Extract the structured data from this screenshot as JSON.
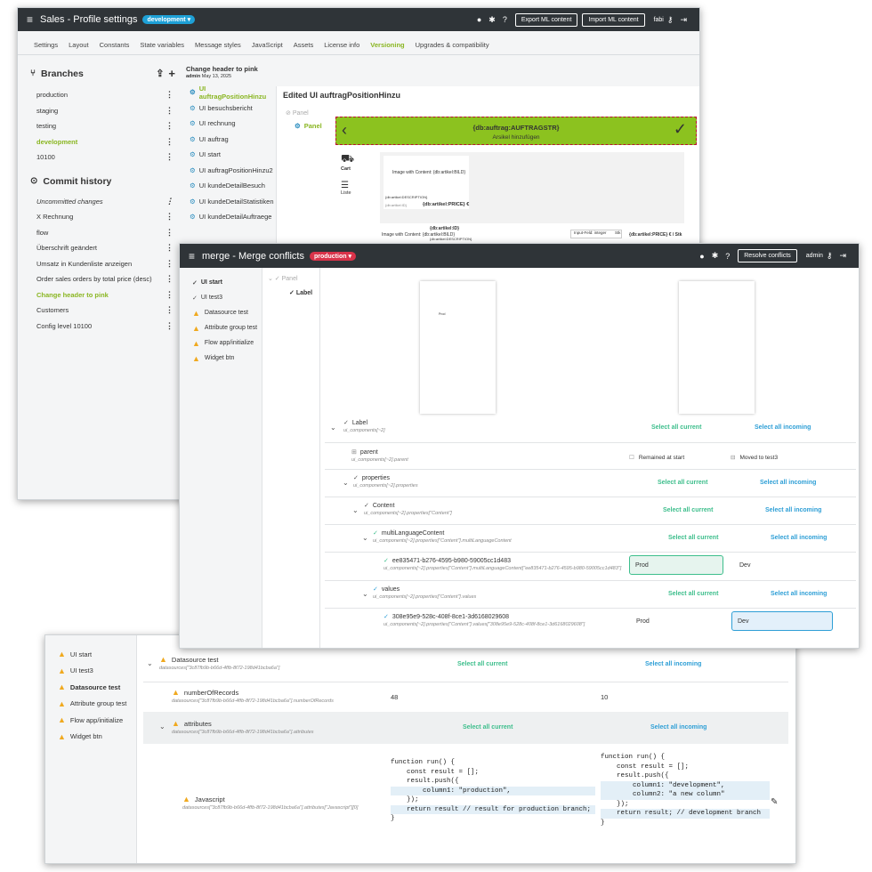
{
  "win1": {
    "title": "Sales - Profile settings",
    "branch_pill": "development ▾",
    "buttons": [
      "Export ML content",
      "Import ML content"
    ],
    "user": "fabi",
    "tabs": [
      "Settings",
      "Layout",
      "Constants",
      "State variables",
      "Message styles",
      "JavaScript",
      "Assets",
      "License info",
      "Versioning",
      "Upgrades & compatibility"
    ],
    "active_tab": "Versioning",
    "branches_title": "Branches",
    "branches": [
      "production",
      "staging",
      "testing",
      "development",
      "10100"
    ],
    "commit_title": "Commit history",
    "commits": [
      "Uncommitted changes",
      "X Rechnung",
      "flow",
      "Überschrift geändert",
      "Umsatz in Kundenliste anzeigen",
      "Order sales orders by total price (desc)",
      "Change header to pink",
      "Customers",
      "Config level 10100"
    ],
    "commit_head": {
      "title": "Change header to pink",
      "author": "admin",
      "date": "May 13, 2025"
    },
    "ui_list": [
      "UI auftragPositionHinzu",
      "UI besuchsbericht",
      "UI rechnung",
      "UI auftrag",
      "UI start",
      "UI auftragPositionHinzu2",
      "UI kundeDetailBesuch",
      "UI kundeDetailStatistiken",
      "UI kundeDetailAuftraege"
    ],
    "edited_title": "Edited UI auftragPositionHinzu",
    "tree": [
      "Panel",
      "Panel"
    ],
    "preview": {
      "header_title": "{db:auftrag:AUFTRAGSTR}",
      "header_sub": "Arsikel hinzufügen",
      "cart": "Cart",
      "liste": "Liste",
      "img1": "Image with Content: {db:artikel:BILD}",
      "desc": "{db:artikel:DESCRIPTION}",
      "artid": "{db:artikel:ID}",
      "price": "{db:artikel:PRICE} €",
      "img2": "Image with Content: {db:artikel:BILD}",
      "artid2": "{db:artikel:ID}",
      "desc2": "{db:artikel:DESCRIPTION}",
      "input_field": "Input-Feld: integer",
      "stk": "Stk",
      "price2": "{db:artikel:PRICE} € / Stk"
    }
  },
  "win2": {
    "title": "merge - Merge conflicts",
    "branch_pill": "production ▾",
    "resolve": "Resolve conflicts",
    "user": "admin",
    "nav": [
      "UI start",
      "UI test3",
      "Datasource test",
      "Attribute group test",
      "Flow app/initialize",
      "Widget btn"
    ],
    "tree": [
      "Panel",
      "Label"
    ],
    "thumb_text": "Prod",
    "select_current": "Select all current",
    "select_incoming": "Select all incoming",
    "rows": [
      {
        "label": "Label",
        "path": "ui_components[~2]"
      },
      {
        "label": "parent",
        "path": "ui_components[~2].parent",
        "left": "Remained at start",
        "right": "Moved to test3"
      },
      {
        "label": "properties",
        "path": "ui_components[~2].properties"
      },
      {
        "label": "Content",
        "path": "ui_components[~2].properties[\"Content\"]"
      },
      {
        "label": "multiLanguageContent",
        "path": "ui_components[~2].properties[\"Content\"].multiLanguageContent"
      },
      {
        "label": "ee835471-b276-4595-b980-59005cc1d483",
        "path": "ui_components[~2].properties[\"Content\"].multiLanguageContent[\"ee835471-b276-4595-b980-59005cc1d483\"]",
        "left": "Prod",
        "right": "Dev"
      },
      {
        "label": "values",
        "path": "ui_components[~2].properties[\"Content\"].values"
      },
      {
        "label": "308e95e9-528c-408f-8ce1-3d6168029608",
        "path": "ui_components[~2].properties[\"Content\"].values[\"308e95e9-528c-408f-8ce1-3d6168029608\"]",
        "left": "Prod",
        "right": "Dev"
      }
    ]
  },
  "win3": {
    "nav": [
      "UI start",
      "UI test3",
      "Datasource test",
      "Attribute group test",
      "Flow app/initialize",
      "Widget btn"
    ],
    "active": "Datasource test",
    "select_current": "Select all current",
    "select_incoming": "Select all incoming",
    "ds": {
      "label": "Datasource test",
      "path": "datasources[\"3c87fb9b-b66d-4ffb-8f72-198d41bcba6a\"]"
    },
    "records": {
      "label": "numberOfRecords",
      "path": "datasources[\"3c87fb9b-b66d-4ffb-8f72-198d41bcba6a\"].numberOfRecords",
      "current": "48",
      "incoming": "10"
    },
    "attrs": {
      "label": "attributes",
      "path": "datasources[\"3c87fb9b-b66d-4ffb-8f72-198d41bcba6a\"].attributes"
    },
    "js": {
      "label": "Javascript",
      "path": "datasources[\"3c87fb9b-b66d-4ffb-8f72-198d41bcba6a\"].attributes[\"Javascript\"][0]"
    },
    "code_left": [
      "function run() {",
      "    const result = [];",
      "",
      "    result.push({",
      "        column1: \"production\",",
      "    });",
      "",
      "    return result // result for production branch;",
      "}"
    ],
    "code_right": [
      "function run() {",
      "    const result = [];",
      "",
      "    result.push({",
      "        column1: \"development\",",
      "        column2: \"a new column\"",
      "    });",
      "",
      "    return result; // development branch",
      "}"
    ]
  },
  "colors": {
    "dark": "#2f3438",
    "green": "#8ab622",
    "blue": "#2e9fd6",
    "teal": "#3dbe8c",
    "warn": "#f0a91f",
    "red": "#d9334a",
    "pill_blue": "#1ea0d6"
  }
}
